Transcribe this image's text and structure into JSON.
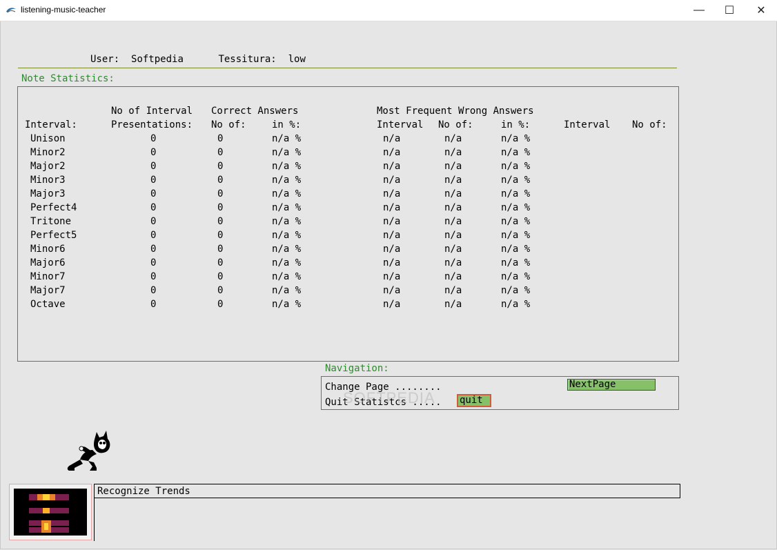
{
  "window": {
    "title": "listening-music-teacher",
    "minimize": "—",
    "maximize": "☐",
    "close": "✕"
  },
  "header": {
    "user_label": "User:",
    "user_value": "Softpedia",
    "tessitura_label": "Tessitura:",
    "tessitura_value": "low"
  },
  "stats": {
    "title": "Note Statistics:",
    "headers": {
      "no_of_interval": "No of Interval",
      "correct_answers": "Correct Answers",
      "most_frequent_wrong": "Most Frequent Wrong Answers",
      "interval": "Interval:",
      "presentations": "Presentations:",
      "no_of": "No of:",
      "in_pct": "in %:",
      "mf_interval": "Interval",
      "mf_no_of": "No of:",
      "mf_in_pct": "in %:",
      "extra_interval": "Interval",
      "extra_no_of": "No of:"
    },
    "rows": [
      {
        "interval": "Unison",
        "presentations": "0",
        "correct": "0",
        "pct": "n/a %",
        "wrong_interval": "n/a",
        "wrong_no": "n/a",
        "wrong_pct": "n/a %"
      },
      {
        "interval": "Minor2",
        "presentations": "0",
        "correct": "0",
        "pct": "n/a %",
        "wrong_interval": "n/a",
        "wrong_no": "n/a",
        "wrong_pct": "n/a %"
      },
      {
        "interval": "Major2",
        "presentations": "0",
        "correct": "0",
        "pct": "n/a %",
        "wrong_interval": "n/a",
        "wrong_no": "n/a",
        "wrong_pct": "n/a %"
      },
      {
        "interval": "Minor3",
        "presentations": "0",
        "correct": "0",
        "pct": "n/a %",
        "wrong_interval": "n/a",
        "wrong_no": "n/a",
        "wrong_pct": "n/a %"
      },
      {
        "interval": "Major3",
        "presentations": "0",
        "correct": "0",
        "pct": "n/a %",
        "wrong_interval": "n/a",
        "wrong_no": "n/a",
        "wrong_pct": "n/a %"
      },
      {
        "interval": "Perfect4",
        "presentations": "0",
        "correct": "0",
        "pct": "n/a %",
        "wrong_interval": "n/a",
        "wrong_no": "n/a",
        "wrong_pct": "n/a %"
      },
      {
        "interval": "Tritone",
        "presentations": "0",
        "correct": "0",
        "pct": "n/a %",
        "wrong_interval": "n/a",
        "wrong_no": "n/a",
        "wrong_pct": "n/a %"
      },
      {
        "interval": "Perfect5",
        "presentations": "0",
        "correct": "0",
        "pct": "n/a %",
        "wrong_interval": "n/a",
        "wrong_no": "n/a",
        "wrong_pct": "n/a %"
      },
      {
        "interval": "Minor6",
        "presentations": "0",
        "correct": "0",
        "pct": "n/a %",
        "wrong_interval": "n/a",
        "wrong_no": "n/a",
        "wrong_pct": "n/a %"
      },
      {
        "interval": "Major6",
        "presentations": "0",
        "correct": "0",
        "pct": "n/a %",
        "wrong_interval": "n/a",
        "wrong_no": "n/a",
        "wrong_pct": "n/a %"
      },
      {
        "interval": "Minor7",
        "presentations": "0",
        "correct": "0",
        "pct": "n/a %",
        "wrong_interval": "n/a",
        "wrong_no": "n/a",
        "wrong_pct": "n/a %"
      },
      {
        "interval": "Major7",
        "presentations": "0",
        "correct": "0",
        "pct": "n/a %",
        "wrong_interval": "n/a",
        "wrong_no": "n/a",
        "wrong_pct": "n/a %"
      },
      {
        "interval": "Octave",
        "presentations": "0",
        "correct": "0",
        "pct": "n/a %",
        "wrong_interval": "n/a",
        "wrong_no": "n/a",
        "wrong_pct": "n/a %"
      }
    ]
  },
  "navigation": {
    "title": "Navigation:",
    "change_page_label": "Change Page ........",
    "quit_label": "Quit Statistcs .....",
    "nextpage_button": "NextPage",
    "quit_button": "quit",
    "watermark": "SOFTPEDIA"
  },
  "trends": {
    "label": "Recognize Trends"
  },
  "icons": {
    "app": "music-note-icon",
    "mascot": "cartoon-cat-mascot"
  },
  "colors": {
    "background": "#e6e6e6",
    "section_green": "#2e8a2e",
    "button_green": "#86c16a",
    "quit_border": "#d05c3a"
  }
}
